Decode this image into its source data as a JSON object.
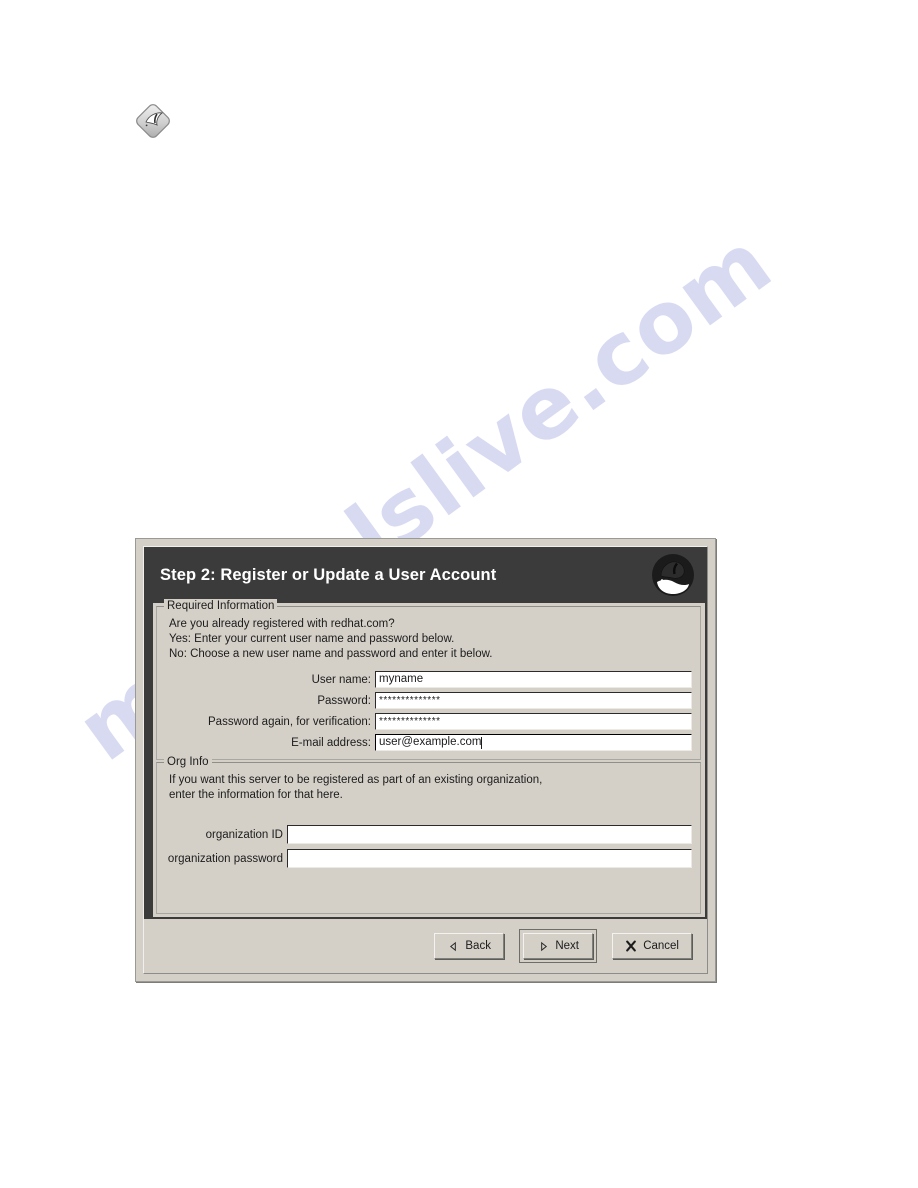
{
  "page": {
    "watermark_text": "manualslive.com",
    "watermark_color": "#b9bce6",
    "background_color": "#ffffff",
    "doc_icon": "diamond-note-icon"
  },
  "dialog": {
    "banner": {
      "title": "Step 2: Register or Update a User Account",
      "logo_icon": "redhat-shadowman-logo",
      "background_color": "#3b3b3b",
      "title_color": "#ffffff"
    },
    "required_group": {
      "title": "Required Information",
      "intro_lines": [
        "Are you already registered with redhat.com?",
        "Yes: Enter your current user name and password below.",
        "No: Choose a new user name and password and enter it below."
      ],
      "fields": [
        {
          "label": "User name:",
          "value": "myname",
          "placeholder": "",
          "masked": false,
          "focused": false,
          "caret": false,
          "name": "user-name-input"
        },
        {
          "label": "Password:",
          "value": "**************",
          "placeholder": "",
          "masked": true,
          "focused": false,
          "caret": false,
          "name": "password-input"
        },
        {
          "label": "Password again, for verification:",
          "value": "**************",
          "placeholder": "",
          "masked": true,
          "focused": false,
          "caret": false,
          "name": "password-verify-input"
        },
        {
          "label": "E-mail address:",
          "value": "user@example.com",
          "placeholder": "",
          "masked": false,
          "focused": true,
          "caret": true,
          "name": "email-input"
        }
      ]
    },
    "org_group": {
      "title": "Org Info",
      "intro_lines": [
        "If you want this server to be registered as part of an existing organization,",
        "enter the information for that here."
      ],
      "fields": [
        {
          "label": "organization ID",
          "value": "",
          "placeholder": "",
          "name": "organization-id-input"
        },
        {
          "label": "organization password",
          "value": "",
          "placeholder": "",
          "name": "organization-password-input"
        }
      ]
    },
    "buttons": [
      {
        "label": "Back",
        "icon": "triangle-left-icon",
        "default": false,
        "name": "back-button"
      },
      {
        "label": "Next",
        "icon": "triangle-right-icon",
        "default": true,
        "name": "next-button"
      },
      {
        "label": "Cancel",
        "icon": "cross-x-icon",
        "default": false,
        "name": "cancel-button"
      }
    ]
  }
}
